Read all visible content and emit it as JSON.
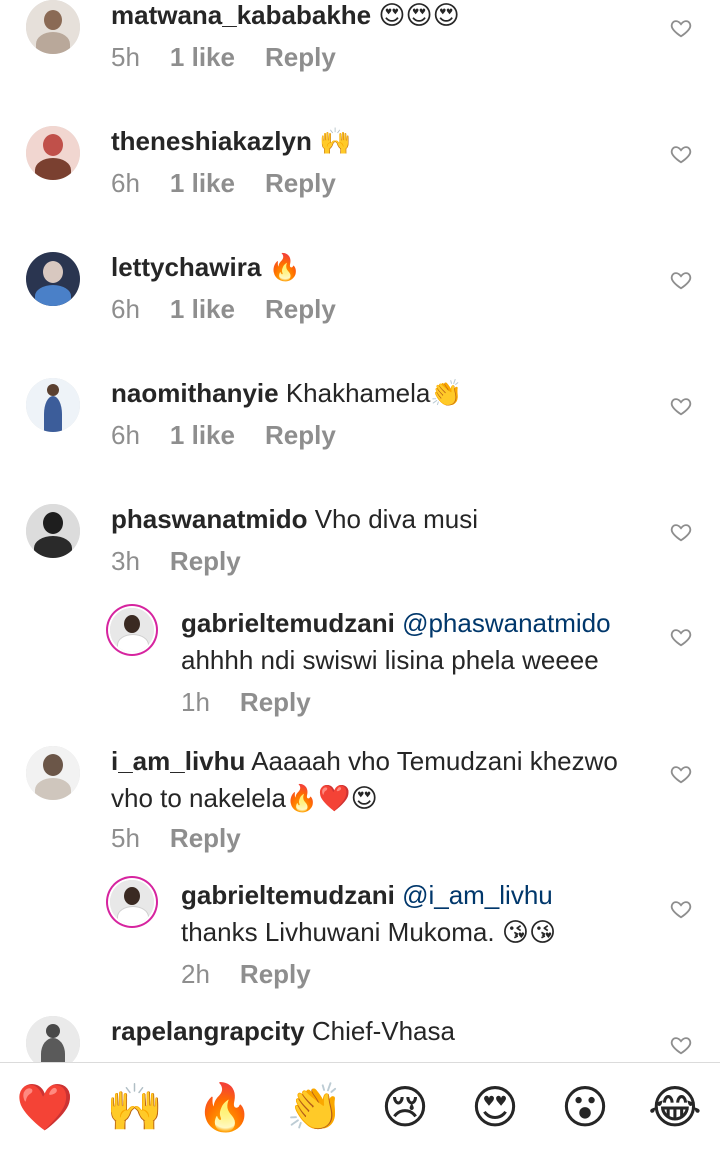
{
  "comments": [
    {
      "user": "matwana_kababakhe",
      "text": "",
      "emoji": "😍😍😍",
      "time": "5h",
      "likes": "1 like",
      "reply": "Reply",
      "avatar_bg": "#e6e0da",
      "avatar_skin": "#8a6a55"
    },
    {
      "user": "theneshiakazlyn",
      "text": "",
      "emoji": "🙌",
      "time": "6h",
      "likes": "1 like",
      "reply": "Reply",
      "avatar_bg": "#f1d6d0",
      "avatar_skin": "#c0504a"
    },
    {
      "user": "lettychawira",
      "text": "",
      "emoji": "🔥",
      "time": "6h",
      "likes": "1 like",
      "reply": "Reply",
      "avatar_bg": "#2a3550",
      "avatar_skin": "#d8c8c0"
    },
    {
      "user": "naomithanyie",
      "text": "Khakhamela",
      "emoji": "👏",
      "time": "6h",
      "likes": "1 like",
      "reply": "Reply",
      "avatar_bg": "#eef3f8",
      "avatar_skin": "#3c5d9a"
    },
    {
      "user": "phaswanatmido",
      "text": "Vho diva musi",
      "emoji": "",
      "time": "3h",
      "likes": "",
      "reply": "Reply",
      "avatar_bg": "#3b3b3b",
      "avatar_skin": "#1e1e1e"
    },
    {
      "user": "gabrieltemudzani",
      "mention": "@phaswanatmido",
      "text": "ahhhh ndi swiswi lisina phela weeee",
      "emoji": "",
      "time": "1h",
      "likes": "",
      "reply": "Reply",
      "avatar_bg": "#e8e8e8",
      "avatar_skin": "#3a2a22"
    },
    {
      "user": "i_am_livhu",
      "text": "Aaaaah vho Temudzani khezwo",
      "text2": "vho to nakelela",
      "emoji": "🔥❤️😍",
      "time": "5h",
      "likes": "",
      "reply": "Reply",
      "avatar_bg": "#f2f2f2",
      "avatar_skin": "#6b5648"
    },
    {
      "user": "gabrieltemudzani",
      "mention": "@i_am_livhu",
      "text": "thanks Livhuwani Mukoma.",
      "emoji": "😘😘",
      "time": "2h",
      "likes": "",
      "reply": "Reply",
      "avatar_bg": "#e8e8e8",
      "avatar_skin": "#3a2a22"
    },
    {
      "user": "rapelangrapcity",
      "text": "Chief-Vhasa",
      "emoji": "",
      "time": "",
      "likes": "",
      "reply": "",
      "avatar_bg": "#eaeaea",
      "avatar_skin": "#4a4a4a"
    }
  ],
  "reactions": [
    "❤️",
    "🙌",
    "🔥",
    "👏",
    "😢",
    "😍",
    "😮",
    "😂"
  ],
  "colors": {
    "text": "#262626",
    "meta": "#8e8e8e",
    "mention": "#00376b",
    "heart_outline": "#8e8e8e",
    "divider": "#dbdbdb"
  },
  "icons": {
    "like": "heart-outline-icon"
  }
}
